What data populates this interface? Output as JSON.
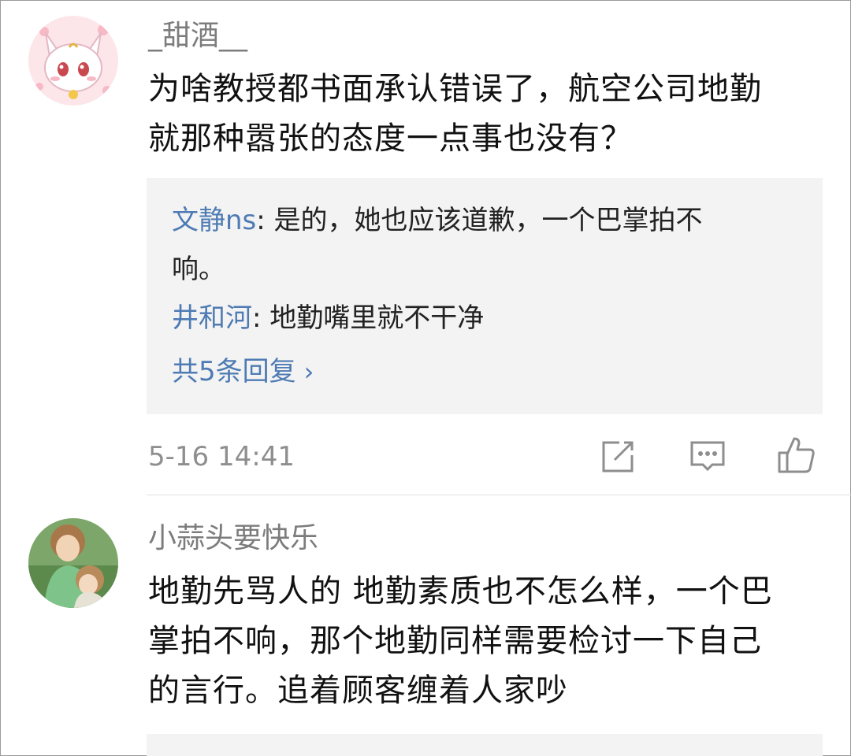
{
  "comments": [
    {
      "username": "_甜酒__",
      "text_lines": [
        "为啥教授都书面承认错误了，航空公司地勤",
        "就那种嚣张的态度一点事也没有？"
      ],
      "replies": [
        {
          "name": "文静ns",
          "sep": ": ",
          "line1": "是的，她也应该道歉，一个巴掌拍不",
          "line2": "响。"
        },
        {
          "name": "井和河",
          "sep": ": ",
          "line1": "地勤嘴里就不干净"
        }
      ],
      "more_replies": "共5条回复",
      "timestamp": "5-16 14:41",
      "actions": [
        "share-icon",
        "comment-icon",
        "like-icon"
      ]
    },
    {
      "username": "小蒜头要快乐",
      "text_lines": [
        "地勤先骂人的 地勤素质也不怎么样，一个巴",
        "掌拍不响，那个地勤同样需要检讨一下自己",
        "的言行。追着顾客缠着人家吵"
      ]
    }
  ],
  "colors": {
    "link": "#4e7bb3",
    "reply_bg": "#f3f3f3",
    "meta": "#8e8e8e",
    "text": "#111111"
  }
}
